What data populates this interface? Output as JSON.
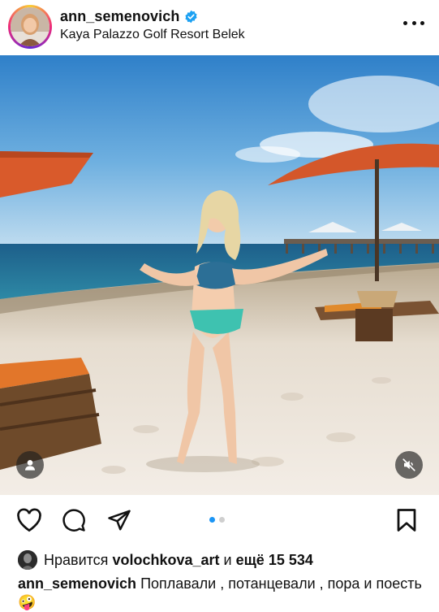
{
  "post": {
    "username": "ann_semenovich",
    "location": "Kaya Palazzo Golf Resort Belek"
  },
  "carousel": {
    "total": 2,
    "active_index": 0
  },
  "likes": {
    "prefix": "Нравится",
    "user": "volochkova_art",
    "connector": "и",
    "more_label": "ещё 15 534"
  },
  "caption": {
    "username": "ann_semenovich",
    "text": "Поплавали , потанцевали , пора и поесть",
    "emoji": "🤪"
  },
  "icons": {
    "verified": "verified-badge-icon",
    "more": "more-options-icon",
    "like": "heart-icon",
    "comment": "comment-icon",
    "share": "send-icon",
    "save": "bookmark-icon",
    "tag": "user-tag-icon",
    "mute": "speaker-muted-icon"
  },
  "colors": {
    "accent": "#1b95f5",
    "verified": "#1da1f2"
  }
}
